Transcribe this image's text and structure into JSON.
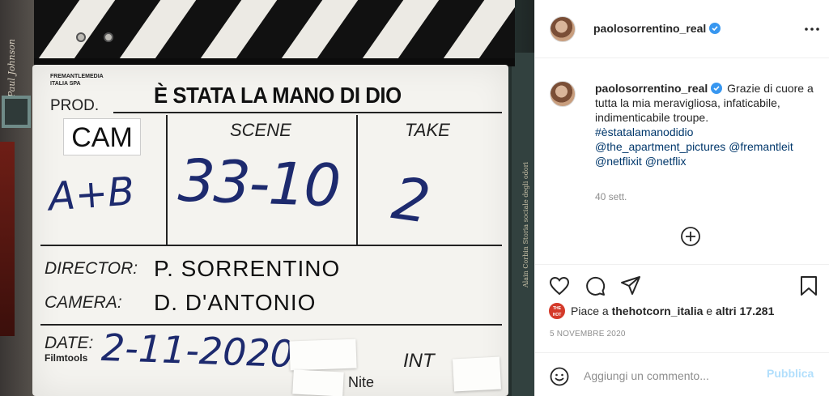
{
  "photo": {
    "slate_company": "FREMANTLEMEDIA\nITALIA SPA",
    "prod_label": "PROD.",
    "title": "È STATA LA MANO DI DIO",
    "cam_label": "CAM",
    "scene_label": "SCENE",
    "take_label": "TAKE",
    "cam_value": "A+B",
    "scene_value": "33-10",
    "take_value": "2",
    "director_label": "DIRECTOR:",
    "director_value": "P. SORRENTINO",
    "camera_label": "CAMERA:",
    "camera_value": "D. D'ANTONIO",
    "date_label": "DATE:",
    "date_value": "2-11-2020",
    "filmtools": "Filmtools",
    "int_label": "INT",
    "nite_label": "Nite",
    "book_spine": "Alain Corbin    Storia sociale degli odori",
    "bg_scroll": "Paul Johnson"
  },
  "header": {
    "username": "paolosorrentino_real"
  },
  "caption": {
    "username": "paolosorrentino_real",
    "text": "Grazie di cuore a tutta la mia meravigliosa, infaticabile, indimenticabile troupe.",
    "hashtag": "#èstatalamanodidio",
    "mentions": [
      "@the_apartment_pictures",
      "@fremantleit",
      "@netflixit",
      "@netflix"
    ],
    "time_ago": "40 sett."
  },
  "likes": {
    "prefix": "Piace a ",
    "user": "thehotcorn_italia",
    "middle": " e ",
    "others": "altri 17.281",
    "avatar_text": "THE HOT CORN"
  },
  "post_date": "5 NOVEMBRE 2020",
  "comment": {
    "placeholder": "Aggiungi un commento...",
    "publish_label": "Pubblica"
  },
  "colors": {
    "verified": "#3897f0",
    "link": "#00376b",
    "publish_disabled": "#b2dffc",
    "muted": "#8e8e8e"
  },
  "icons": [
    "more-icon",
    "verified-icon",
    "add-circle-icon",
    "heart-icon",
    "comment-icon",
    "share-icon",
    "bookmark-icon",
    "emoji-icon"
  ]
}
